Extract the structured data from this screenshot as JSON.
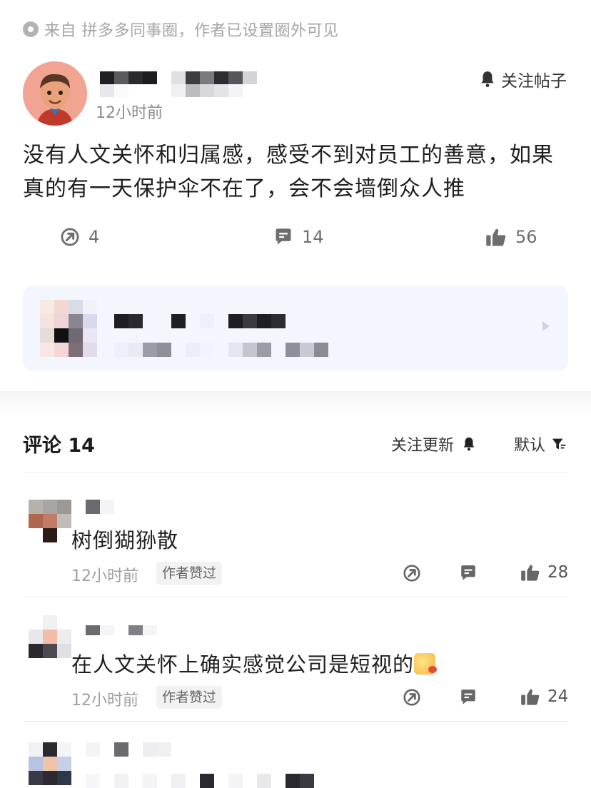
{
  "post": {
    "source": "来自 拼多多同事圈，作者已设置圈外可见",
    "time": "12小时前",
    "follow_label": "关注帖子",
    "text": "没有人文关怀和归属感，感受不到对员工的善意，如果真的有一天保护伞不在了，会不会墙倒众人推",
    "stats": {
      "shares": "4",
      "comments": "14",
      "likes": "56"
    }
  },
  "comments_header": {
    "title": "评论 14",
    "follow_updates": "关注更新",
    "sort": "默认"
  },
  "comments": [
    {
      "text": "树倒猢狲散",
      "time": "12小时前",
      "badge": "作者赞过",
      "likes": "28"
    },
    {
      "text": "在人文关怀上确实感觉公司是短视的",
      "time": "12小时前",
      "badge": "作者赞过",
      "likes": "24"
    }
  ],
  "icons": {
    "source": "eye-dot-icon",
    "follow": "bell-icon",
    "share": "share-arrow-icon",
    "comment": "comment-bubble-icon",
    "like": "thumbs-up-icon",
    "sort": "filter-sort-icon",
    "card": "chevron-right-icon"
  },
  "colors": {
    "muted": "#a6a6a6",
    "card_bg": "#f4f6fd",
    "avatar_bg": "#f0a898"
  }
}
